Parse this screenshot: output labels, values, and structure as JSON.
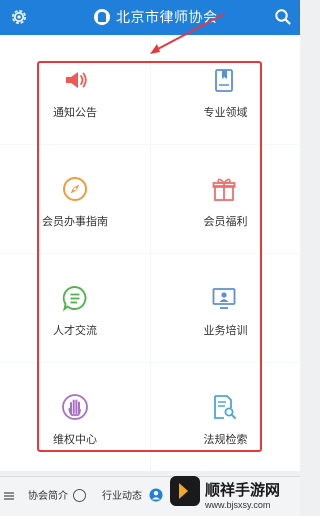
{
  "header": {
    "title": "北京市律师协会",
    "settings_icon": "gear-icon",
    "search_icon": "search-icon",
    "colors": {
      "bar": "#1f7fdb",
      "text": "#ffffff"
    }
  },
  "grid": [
    {
      "label": "通知公告",
      "icon": "megaphone-icon",
      "color": "#f05a55"
    },
    {
      "label": "专业领域",
      "icon": "bookmark-book-icon",
      "color": "#5b8fd6"
    },
    {
      "label": "会员办事指南",
      "icon": "compass-icon",
      "color": "#f29a3c"
    },
    {
      "label": "会员福利",
      "icon": "gift-icon",
      "color": "#f26d6d"
    },
    {
      "label": "人才交流",
      "icon": "chat-bubble-icon",
      "color": "#52b34e"
    },
    {
      "label": "业务培训",
      "icon": "presentation-icon",
      "color": "#5b8fd6"
    },
    {
      "label": "维权中心",
      "icon": "raised-hand-icon",
      "color": "#a86fc6"
    },
    {
      "label": "法规检索",
      "icon": "document-search-icon",
      "color": "#4da7d9"
    }
  ],
  "annotation": {
    "color": "#e8383d"
  },
  "bottom_nav": [
    {
      "label": "协会简介",
      "icon": "menu-icon"
    },
    {
      "label": "行业动态",
      "icon": "info-icon"
    },
    {
      "label": "",
      "icon": "person-icon"
    }
  ],
  "watermark": {
    "text": "顺祥手游网",
    "url": "www.bjsxsy.com"
  }
}
